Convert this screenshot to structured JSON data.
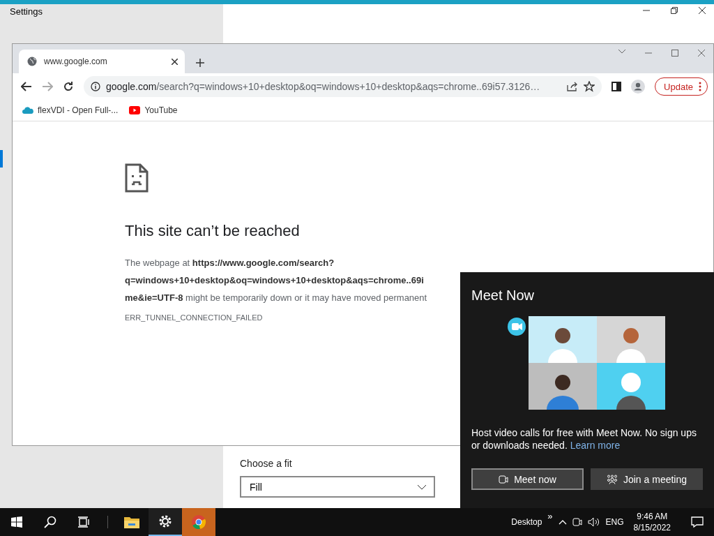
{
  "settings_window": {
    "title": "Settings",
    "fit": {
      "label": "Choose a fit",
      "value": "Fill"
    }
  },
  "browser": {
    "tab": {
      "title": "www.google.com"
    },
    "address": {
      "host": "google.com",
      "rest": "/search?q=windows+10+desktop&oq=windows+10+desktop&aqs=chrome..69i57.3126…"
    },
    "update": "Update",
    "bookmarks": [
      {
        "kind": "cloud",
        "label": "flexVDI - Open Full-..."
      },
      {
        "kind": "video",
        "label": "YouTube"
      }
    ],
    "error": {
      "title": "This site can’t be reached",
      "lines": [
        "The webpage at **https://www.google.com/search?**",
        "**q=windows+10+desktop&oq=windows+10+desktop&aqs=chrome..69i**",
        "**me&ie=UTF-8** might be temporarily down or it may have moved permanent"
      ],
      "code": "ERR_TUNNEL_CONNECTION_FAILED"
    }
  },
  "meet_now": {
    "title": "Meet Now",
    "description": "Host video calls for free with Meet Now. No sign ups or downloads needed.",
    "link": "Learn more",
    "buttons": [
      {
        "kind": "meet",
        "label": "Meet now",
        "focused": true
      },
      {
        "kind": "join",
        "label": "Join a meeting",
        "focused": false
      }
    ]
  },
  "taskbar": {
    "apps": [
      {
        "kind": "explorer",
        "running": false,
        "highlighted": false
      },
      {
        "kind": "settings",
        "running": true,
        "highlighted": false
      },
      {
        "kind": "chrome",
        "running": false,
        "highlighted": true
      }
    ],
    "toolbar": "Desktop",
    "more": "»",
    "language": "ENG",
    "time": "9:46 AM",
    "date": "8/15/2022"
  }
}
